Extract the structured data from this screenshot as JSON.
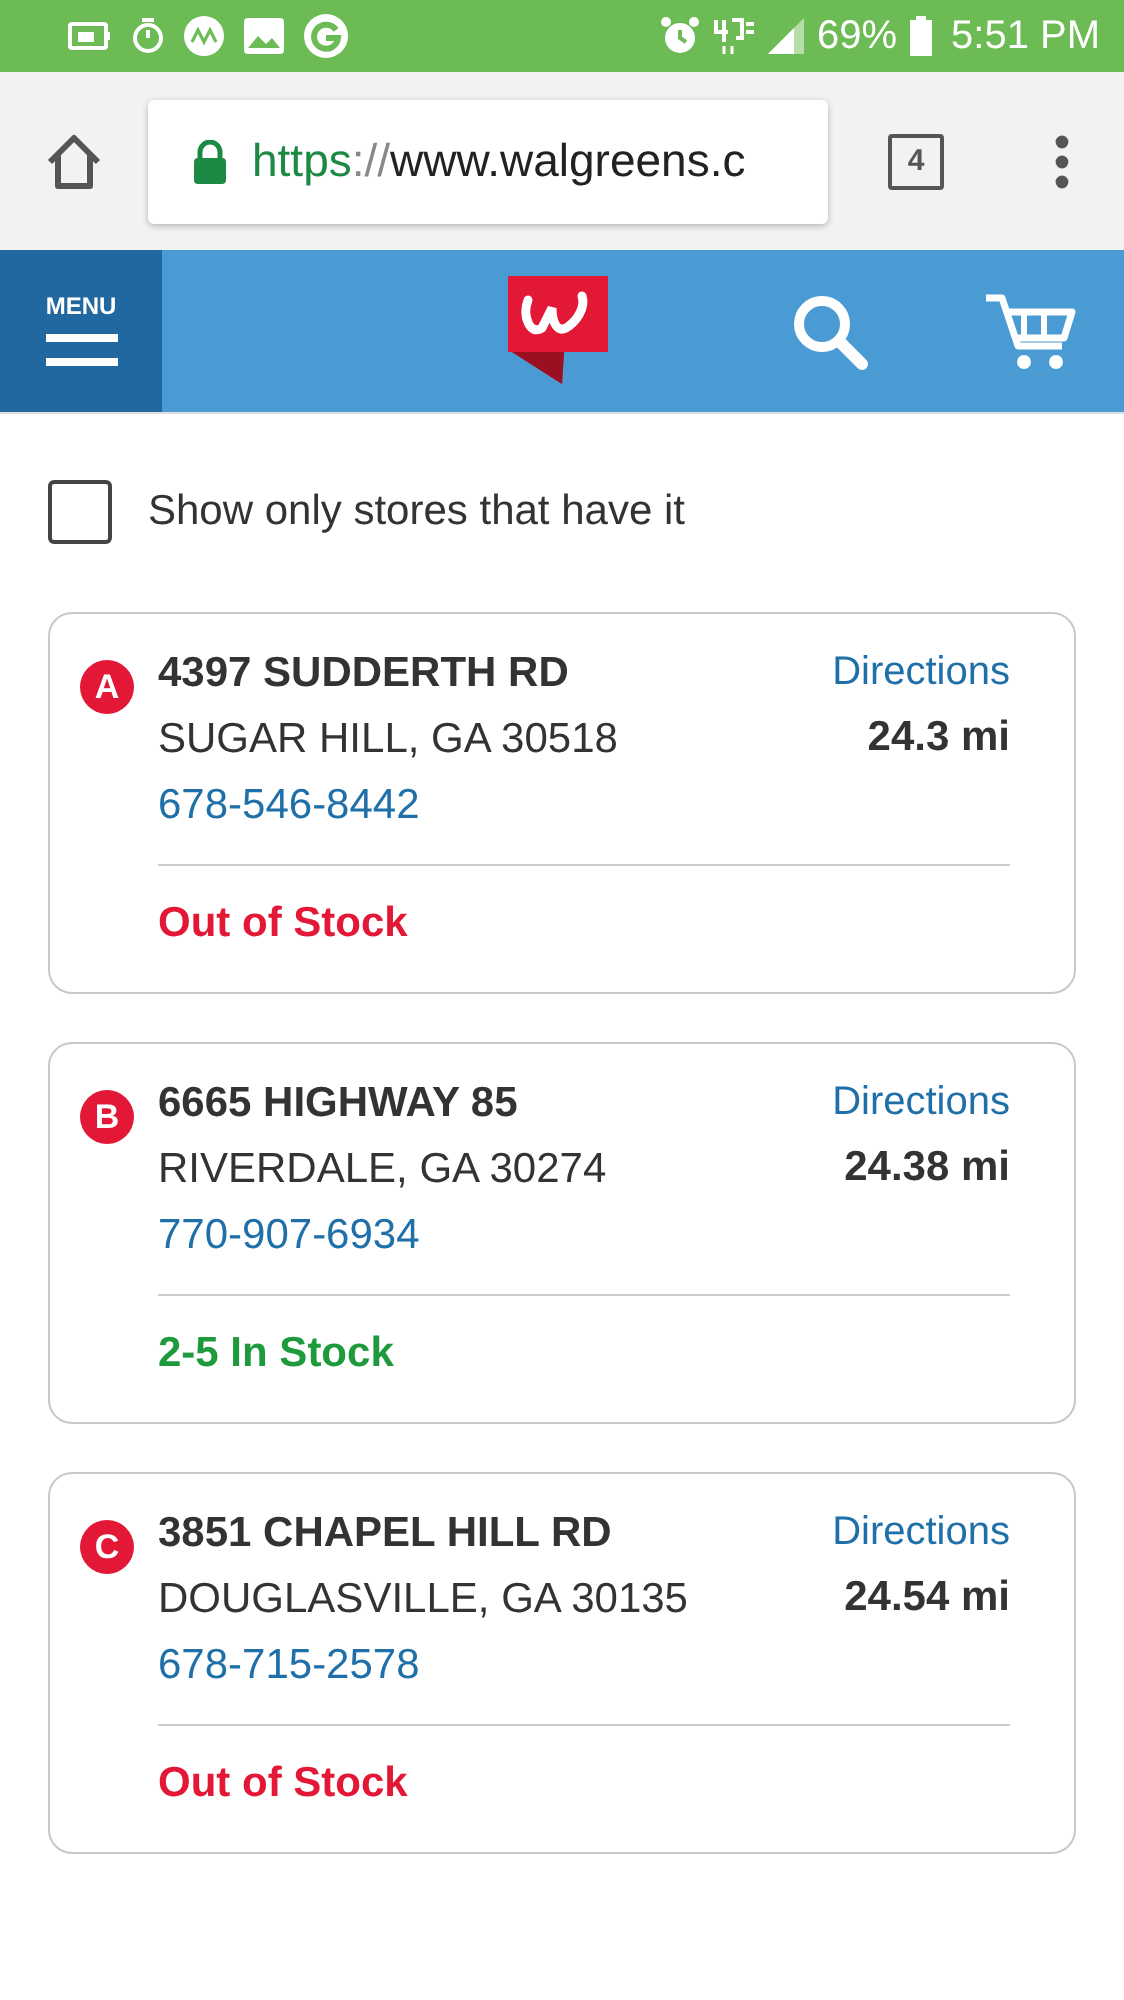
{
  "status_bar": {
    "battery": "69%",
    "time": "5:51 PM"
  },
  "browser": {
    "url": "https://www.walgreens.c",
    "tab_count": "4"
  },
  "header": {
    "menu_label": "MENU"
  },
  "filter": {
    "label": "Show only stores that have it",
    "checked": false
  },
  "stores": [
    {
      "marker": "A",
      "address": "4397 SUDDERTH RD",
      "city": "SUGAR HILL, GA 30518",
      "phone": "678-546-8442",
      "directions": "Directions",
      "distance": "24.3 mi",
      "stock": "Out of Stock",
      "in_stock": false
    },
    {
      "marker": "B",
      "address": "6665 HIGHWAY 85",
      "city": "RIVERDALE, GA 30274",
      "phone": "770-907-6934",
      "directions": "Directions",
      "distance": "24.38 mi",
      "stock": "2-5 In Stock",
      "in_stock": true
    },
    {
      "marker": "C",
      "address": "3851 CHAPEL HILL RD",
      "city": "DOUGLASVILLE, GA 30135",
      "phone": "678-715-2578",
      "directions": "Directions",
      "distance": "24.54 mi",
      "stock": "Out of Stock",
      "in_stock": false
    }
  ]
}
